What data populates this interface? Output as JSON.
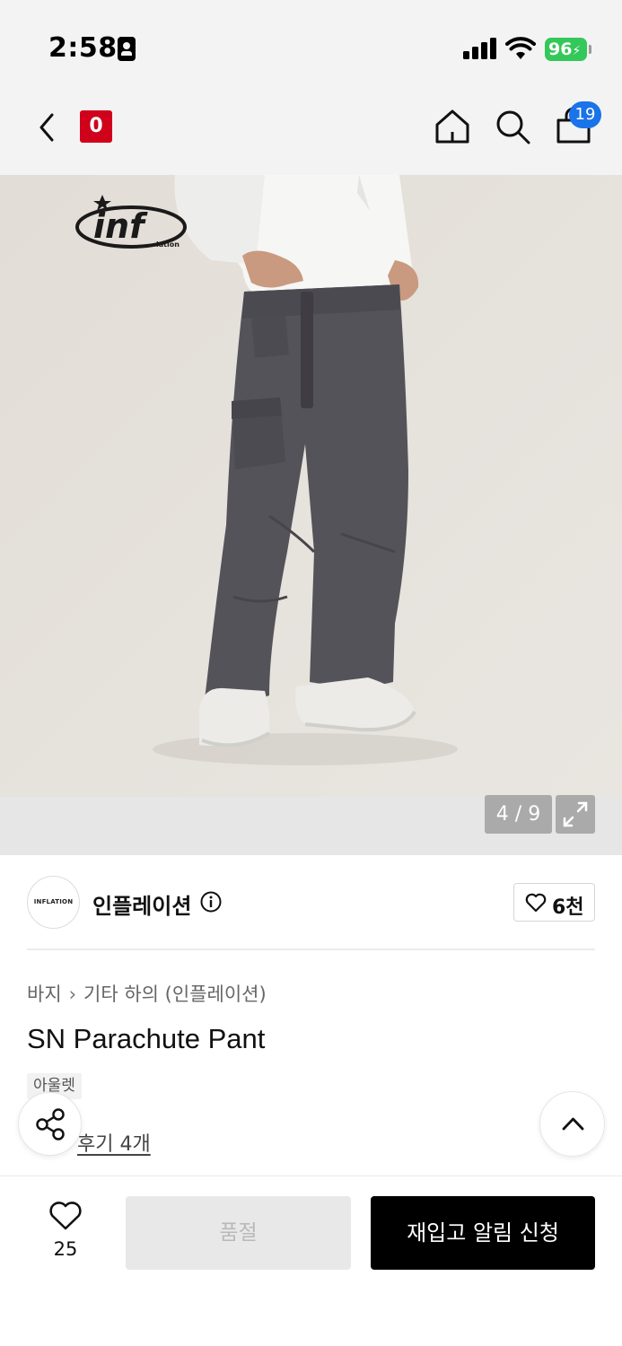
{
  "status_bar": {
    "time": "2:58",
    "battery": "96"
  },
  "nav": {
    "brand_logo_text": "0",
    "cart_badge": "19"
  },
  "image_logo_text": "inf",
  "image_logo_sub": "lation",
  "gallery": {
    "page_indicator": "4 / 9"
  },
  "brand": {
    "avatar_text": "INFLATION",
    "name": "인플레이션",
    "likes": "6천"
  },
  "product": {
    "breadcrumb": [
      "바지",
      "기타 하의 (인플레이션)"
    ],
    "title": "SN Parachute Pant",
    "tag": "아울렛",
    "rating": "4",
    "reviews": "후기 4개"
  },
  "bottom": {
    "wish_count": "25",
    "soldout_label": "품절",
    "restock_label": "재입고 알림 신청"
  },
  "colors": {
    "accent": "#d0021b",
    "badge": "#1a73e8",
    "battery": "#34c759",
    "pants": "#55535a",
    "background": "#e5e1dc"
  },
  "icons": [
    "back-icon",
    "home-icon",
    "search-icon",
    "shopping-bag-icon",
    "expand-icon",
    "info-icon",
    "heart-icon",
    "star-icon",
    "share-icon",
    "chevron-up-icon"
  ]
}
